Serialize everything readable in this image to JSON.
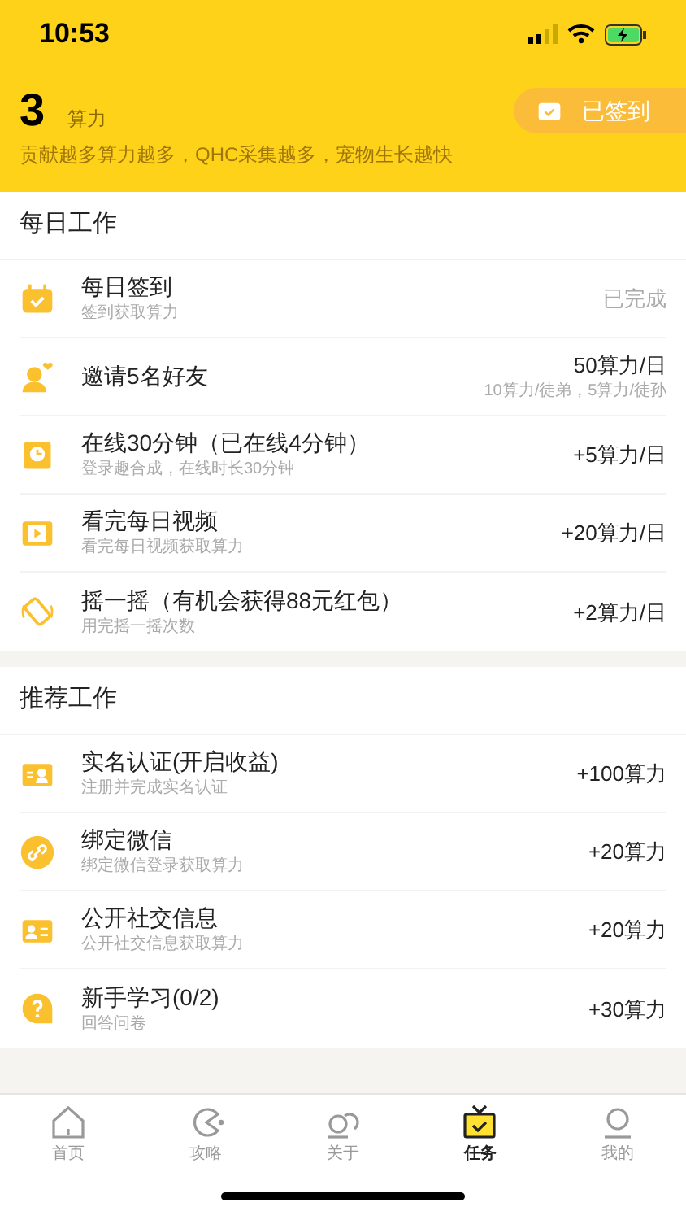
{
  "status_bar": {
    "time": "10:53"
  },
  "header": {
    "points": "3",
    "unit": "算力",
    "tagline": "贡献越多算力越多，QHC采集越多，宠物生长越快",
    "sign_button": {
      "label": "已签到",
      "checked": true
    }
  },
  "sections": [
    {
      "title": "每日工作",
      "tasks": [
        {
          "title": "每日签到",
          "subtitle": "签到获取算力",
          "reward": "已完成",
          "done": true
        },
        {
          "title": "邀请5名好友",
          "reward": "50算力/日",
          "reward_note": "10算力/徒弟，5算力/徒孙",
          "done": false
        },
        {
          "title": "在线30分钟（已在线4分钟）",
          "subtitle": "登录趣合成，在线时长30分钟",
          "reward": "+5算力/日",
          "done": false
        },
        {
          "title": "看完每日视频",
          "subtitle": "看完每日视频获取算力",
          "reward": "+20算力/日",
          "done": false
        },
        {
          "title": "摇一摇（有机会获得88元红包）",
          "subtitle": "用完摇一摇次数",
          "reward": "+2算力/日",
          "done": false
        }
      ]
    },
    {
      "title": "推荐工作",
      "tasks": [
        {
          "title": "实名认证(开启收益)",
          "subtitle": "注册并完成实名认证",
          "reward": "+100算力",
          "done": false
        },
        {
          "title": "绑定微信",
          "subtitle": "绑定微信登录获取算力",
          "reward": "+20算力",
          "done": false
        },
        {
          "title": "公开社交信息",
          "subtitle": "公开社交信息获取算力",
          "reward": "+20算力",
          "done": false
        },
        {
          "title": "新手学习(0/2)",
          "subtitle": "回答问卷",
          "reward": "+30算力",
          "done": false
        }
      ]
    }
  ],
  "tab_bar": [
    {
      "label": "首页",
      "selected": false
    },
    {
      "label": "攻略",
      "selected": false
    },
    {
      "label": "关于",
      "selected": false
    },
    {
      "label": "任务",
      "selected": true
    },
    {
      "label": "我的",
      "selected": false
    }
  ]
}
